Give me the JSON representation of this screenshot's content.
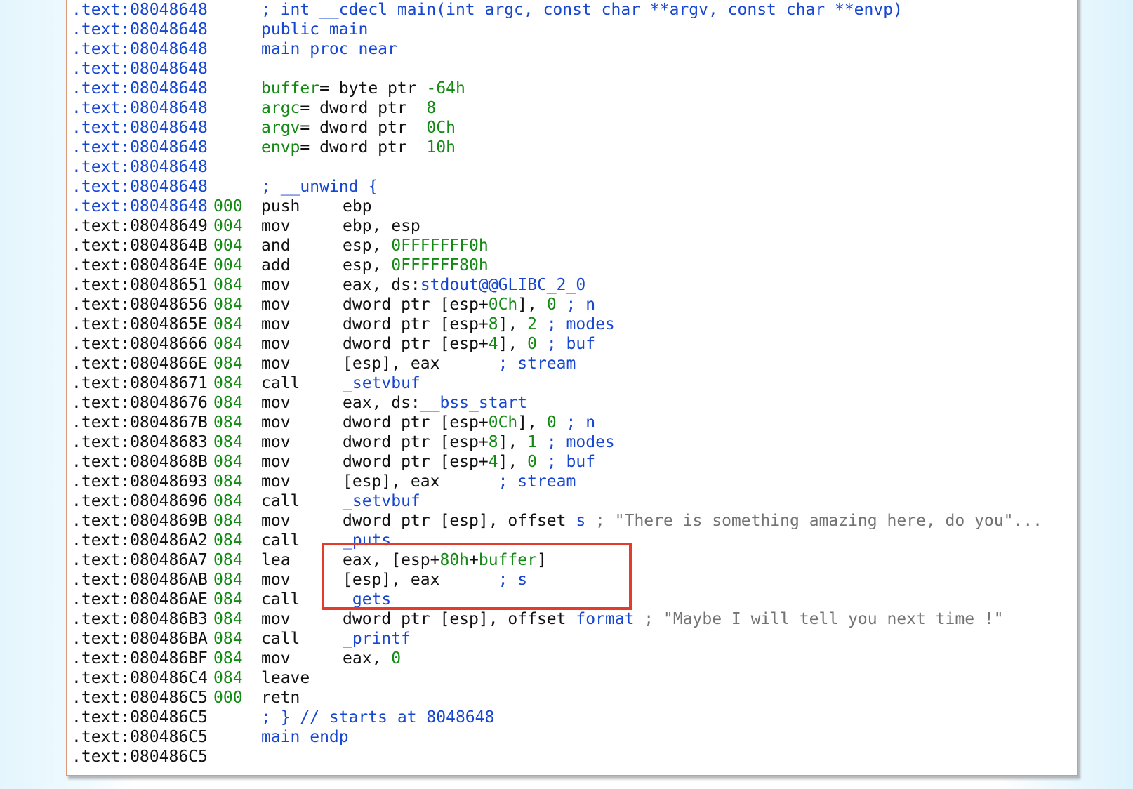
{
  "colors": {
    "address_black": "#111111",
    "address_blue": "#1646d2",
    "green": "#138a13",
    "comment_gray": "#737373",
    "highlight_red": "#e23c2d"
  },
  "lines": [
    {
      "addr": ".text:08048648",
      "addr_color": "blue",
      "sp": "",
      "parts": [],
      "mn": ""
    },
    {
      "addr": ".text:08048648",
      "addr_color": "blue",
      "sp": "",
      "mn": "",
      "parts": [
        {
          "t": "; int __cdecl main(int argc, const char **argv, const char **envp)",
          "c": "blue"
        }
      ]
    },
    {
      "addr": ".text:08048648",
      "addr_color": "blue",
      "sp": "",
      "mn": "",
      "parts": [
        {
          "t": "public main",
          "c": "blue"
        }
      ]
    },
    {
      "addr": ".text:08048648",
      "addr_color": "blue",
      "sp": "",
      "mn": "",
      "parts": [
        {
          "t": "main proc near",
          "c": "blue"
        }
      ]
    },
    {
      "addr": ".text:08048648",
      "addr_color": "blue",
      "sp": "",
      "mn": "",
      "parts": []
    },
    {
      "addr": ".text:08048648",
      "addr_color": "blue",
      "sp": "",
      "mn": "",
      "parts": [
        {
          "t": "buffer",
          "c": "green"
        },
        {
          "t": "= byte ptr ",
          "c": "black"
        },
        {
          "t": "-64h",
          "c": "green"
        }
      ]
    },
    {
      "addr": ".text:08048648",
      "addr_color": "blue",
      "sp": "",
      "mn": "",
      "parts": [
        {
          "t": "argc",
          "c": "green"
        },
        {
          "t": "= dword ptr  ",
          "c": "black"
        },
        {
          "t": "8",
          "c": "green"
        }
      ]
    },
    {
      "addr": ".text:08048648",
      "addr_color": "blue",
      "sp": "",
      "mn": "",
      "parts": [
        {
          "t": "argv",
          "c": "green"
        },
        {
          "t": "= dword ptr  ",
          "c": "black"
        },
        {
          "t": "0Ch",
          "c": "green"
        }
      ]
    },
    {
      "addr": ".text:08048648",
      "addr_color": "blue",
      "sp": "",
      "mn": "",
      "parts": [
        {
          "t": "envp",
          "c": "green"
        },
        {
          "t": "= dword ptr  ",
          "c": "black"
        },
        {
          "t": "10h",
          "c": "green"
        }
      ]
    },
    {
      "addr": ".text:08048648",
      "addr_color": "blue",
      "sp": "",
      "mn": "",
      "parts": []
    },
    {
      "addr": ".text:08048648",
      "addr_color": "blue",
      "sp": "",
      "mn": "",
      "parts": [
        {
          "t": "; __unwind {",
          "c": "blue"
        }
      ]
    },
    {
      "addr": ".text:08048648",
      "addr_color": "blue",
      "sp": "000",
      "mn": "push",
      "parts": [
        {
          "t": "ebp",
          "c": "black"
        }
      ]
    },
    {
      "addr": ".text:08048649",
      "addr_color": "black",
      "sp": "004",
      "mn": "mov",
      "parts": [
        {
          "t": "ebp, esp",
          "c": "black"
        }
      ]
    },
    {
      "addr": ".text:0804864B",
      "addr_color": "black",
      "sp": "004",
      "mn": "and",
      "parts": [
        {
          "t": "esp, ",
          "c": "black"
        },
        {
          "t": "0FFFFFFF0h",
          "c": "green"
        }
      ]
    },
    {
      "addr": ".text:0804864E",
      "addr_color": "black",
      "sp": "004",
      "mn": "add",
      "parts": [
        {
          "t": "esp, ",
          "c": "black"
        },
        {
          "t": "0FFFFFF80h",
          "c": "green"
        }
      ]
    },
    {
      "addr": ".text:08048651",
      "addr_color": "black",
      "sp": "084",
      "mn": "mov",
      "parts": [
        {
          "t": "eax, ds:",
          "c": "black"
        },
        {
          "t": "stdout@@GLIBC_2_0",
          "c": "blue"
        }
      ]
    },
    {
      "addr": ".text:08048656",
      "addr_color": "black",
      "sp": "084",
      "mn": "mov",
      "parts": [
        {
          "t": "dword ptr [esp+",
          "c": "black"
        },
        {
          "t": "0Ch",
          "c": "green"
        },
        {
          "t": "], ",
          "c": "black"
        },
        {
          "t": "0",
          "c": "green"
        },
        {
          "t": " ; n",
          "c": "blue"
        }
      ]
    },
    {
      "addr": ".text:0804865E",
      "addr_color": "black",
      "sp": "084",
      "mn": "mov",
      "parts": [
        {
          "t": "dword ptr [esp+",
          "c": "black"
        },
        {
          "t": "8",
          "c": "green"
        },
        {
          "t": "], ",
          "c": "black"
        },
        {
          "t": "2",
          "c": "green"
        },
        {
          "t": " ; modes",
          "c": "blue"
        }
      ]
    },
    {
      "addr": ".text:08048666",
      "addr_color": "black",
      "sp": "084",
      "mn": "mov",
      "parts": [
        {
          "t": "dword ptr [esp+",
          "c": "black"
        },
        {
          "t": "4",
          "c": "green"
        },
        {
          "t": "], ",
          "c": "black"
        },
        {
          "t": "0",
          "c": "green"
        },
        {
          "t": " ; buf",
          "c": "blue"
        }
      ]
    },
    {
      "addr": ".text:0804866E",
      "addr_color": "black",
      "sp": "084",
      "mn": "mov",
      "parts": [
        {
          "t": "[esp], eax      ",
          "c": "black"
        },
        {
          "t": "; stream",
          "c": "blue"
        }
      ]
    },
    {
      "addr": ".text:08048671",
      "addr_color": "black",
      "sp": "084",
      "mn": "call",
      "parts": [
        {
          "t": "_setvbuf",
          "c": "blue"
        }
      ]
    },
    {
      "addr": ".text:08048676",
      "addr_color": "black",
      "sp": "084",
      "mn": "mov",
      "parts": [
        {
          "t": "eax, ds:",
          "c": "black"
        },
        {
          "t": "__bss_start",
          "c": "blue"
        }
      ]
    },
    {
      "addr": ".text:0804867B",
      "addr_color": "black",
      "sp": "084",
      "mn": "mov",
      "parts": [
        {
          "t": "dword ptr [esp+",
          "c": "black"
        },
        {
          "t": "0Ch",
          "c": "green"
        },
        {
          "t": "], ",
          "c": "black"
        },
        {
          "t": "0",
          "c": "green"
        },
        {
          "t": " ; n",
          "c": "blue"
        }
      ]
    },
    {
      "addr": ".text:08048683",
      "addr_color": "black",
      "sp": "084",
      "mn": "mov",
      "parts": [
        {
          "t": "dword ptr [esp+",
          "c": "black"
        },
        {
          "t": "8",
          "c": "green"
        },
        {
          "t": "], ",
          "c": "black"
        },
        {
          "t": "1",
          "c": "green"
        },
        {
          "t": " ; modes",
          "c": "blue"
        }
      ]
    },
    {
      "addr": ".text:0804868B",
      "addr_color": "black",
      "sp": "084",
      "mn": "mov",
      "parts": [
        {
          "t": "dword ptr [esp+",
          "c": "black"
        },
        {
          "t": "4",
          "c": "green"
        },
        {
          "t": "], ",
          "c": "black"
        },
        {
          "t": "0",
          "c": "green"
        },
        {
          "t": " ; buf",
          "c": "blue"
        }
      ]
    },
    {
      "addr": ".text:08048693",
      "addr_color": "black",
      "sp": "084",
      "mn": "mov",
      "parts": [
        {
          "t": "[esp], eax      ",
          "c": "black"
        },
        {
          "t": "; stream",
          "c": "blue"
        }
      ]
    },
    {
      "addr": ".text:08048696",
      "addr_color": "black",
      "sp": "084",
      "mn": "call",
      "parts": [
        {
          "t": "_setvbuf",
          "c": "blue"
        }
      ]
    },
    {
      "addr": ".text:0804869B",
      "addr_color": "black",
      "sp": "084",
      "mn": "mov",
      "parts": [
        {
          "t": "dword ptr [esp], offset ",
          "c": "black"
        },
        {
          "t": "s",
          "c": "blue"
        },
        {
          "t": " ; \"There is something amazing here, do you\"...",
          "c": "gray"
        }
      ]
    },
    {
      "addr": ".text:080486A2",
      "addr_color": "black",
      "sp": "084",
      "mn": "call",
      "parts": [
        {
          "t": "_puts",
          "c": "blue"
        }
      ]
    },
    {
      "addr": ".text:080486A7",
      "addr_color": "black",
      "sp": "084",
      "mn": "lea",
      "parts": [
        {
          "t": "eax, [esp+",
          "c": "black"
        },
        {
          "t": "80h",
          "c": "green"
        },
        {
          "t": "+",
          "c": "black"
        },
        {
          "t": "buffer",
          "c": "green"
        },
        {
          "t": "]",
          "c": "black"
        }
      ]
    },
    {
      "addr": ".text:080486AB",
      "addr_color": "black",
      "sp": "084",
      "mn": "mov",
      "parts": [
        {
          "t": "[esp], eax      ",
          "c": "black"
        },
        {
          "t": "; s",
          "c": "blue"
        }
      ]
    },
    {
      "addr": ".text:080486AE",
      "addr_color": "black",
      "sp": "084",
      "mn": "call",
      "parts": [
        {
          "t": "_gets",
          "c": "blue"
        }
      ]
    },
    {
      "addr": ".text:080486B3",
      "addr_color": "black",
      "sp": "084",
      "mn": "mov",
      "parts": [
        {
          "t": "dword ptr [esp], offset ",
          "c": "black"
        },
        {
          "t": "format",
          "c": "blue"
        },
        {
          "t": " ; \"Maybe I will tell you next time !\"",
          "c": "gray"
        }
      ]
    },
    {
      "addr": ".text:080486BA",
      "addr_color": "black",
      "sp": "084",
      "mn": "call",
      "parts": [
        {
          "t": "_printf",
          "c": "blue"
        }
      ]
    },
    {
      "addr": ".text:080486BF",
      "addr_color": "black",
      "sp": "084",
      "mn": "mov",
      "parts": [
        {
          "t": "eax, ",
          "c": "black"
        },
        {
          "t": "0",
          "c": "green"
        }
      ]
    },
    {
      "addr": ".text:080486C4",
      "addr_color": "black",
      "sp": "084",
      "mn": "leave",
      "parts": []
    },
    {
      "addr": ".text:080486C5",
      "addr_color": "black",
      "sp": "000",
      "mn": "retn",
      "parts": []
    },
    {
      "addr": ".text:080486C5",
      "addr_color": "black",
      "sp": "",
      "mn": "",
      "parts": [
        {
          "t": "; } // starts at 8048648",
          "c": "blue"
        }
      ]
    },
    {
      "addr": ".text:080486C5",
      "addr_color": "black",
      "sp": "",
      "mn": "",
      "parts": [
        {
          "t": "main endp",
          "c": "blue"
        }
      ]
    },
    {
      "addr": ".text:080486C5",
      "addr_color": "black",
      "sp": "",
      "mn": "",
      "parts": []
    }
  ]
}
